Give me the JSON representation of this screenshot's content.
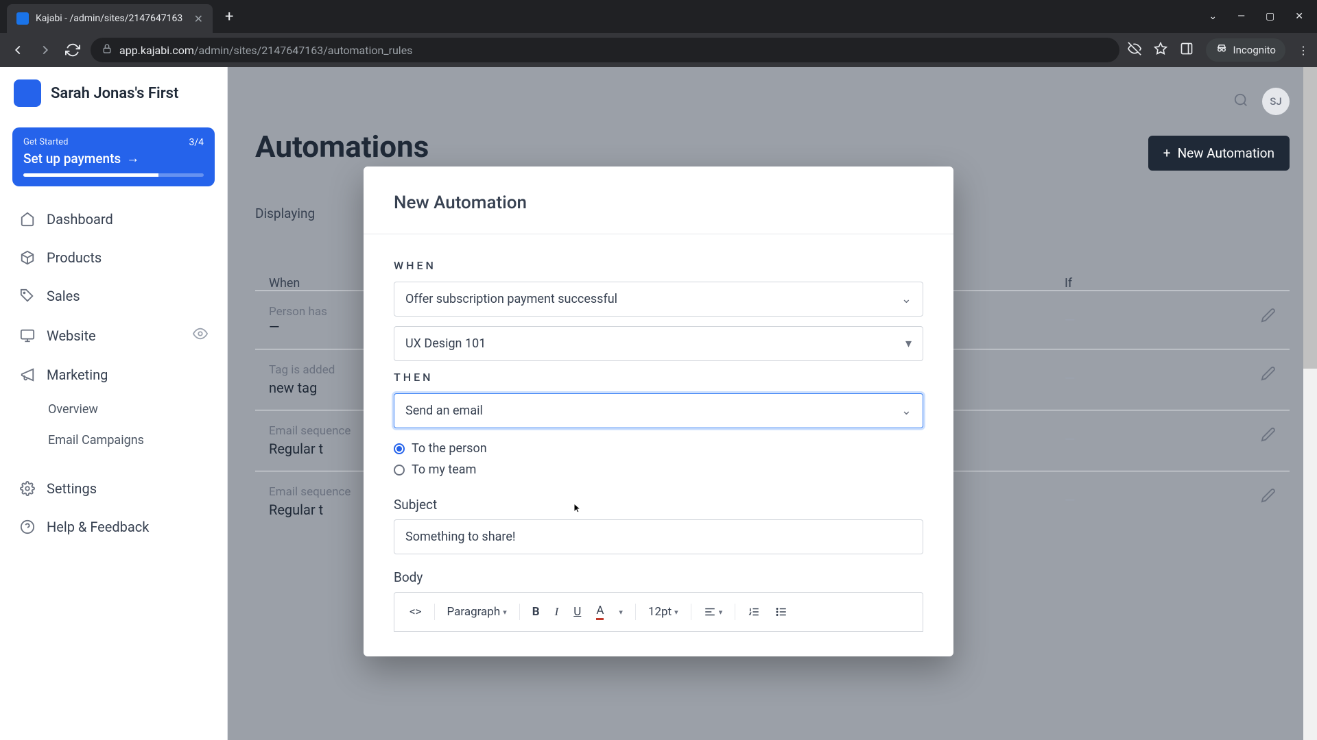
{
  "browser": {
    "tab_title": "Kajabi - /admin/sites/2147647163",
    "url_host": "app.kajabi.com",
    "url_path": "/admin/sites/2147647163/automation_rules",
    "incognito": "Incognito"
  },
  "sidebar": {
    "brand": "Sarah Jonas's First",
    "setup": {
      "small": "Get Started",
      "count": "3/4",
      "main": "Set up payments"
    },
    "items": [
      {
        "label": "Dashboard"
      },
      {
        "label": "Products"
      },
      {
        "label": "Sales"
      },
      {
        "label": "Website"
      },
      {
        "label": "Marketing"
      },
      {
        "label": "Settings"
      },
      {
        "label": "Help & Feedback"
      }
    ],
    "sub": [
      {
        "label": "Overview"
      },
      {
        "label": "Email Campaigns"
      }
    ]
  },
  "topbar": {
    "avatar": "SJ"
  },
  "page": {
    "title": "Automations",
    "new_btn": "New Automation",
    "displaying": "Displaying",
    "cols": {
      "when": "When",
      "if": "If"
    },
    "rows": [
      {
        "title": "Person has",
        "sub": "—"
      },
      {
        "title": "Tag is added",
        "sub": "new tag"
      },
      {
        "title": "Email sequence",
        "sub": "Regular t"
      },
      {
        "title": "Email sequence",
        "sub": "Regular t"
      }
    ]
  },
  "modal": {
    "title": "New Automation",
    "when_label": "WHEN",
    "when_select": "Offer subscription payment successful",
    "when_select2": "UX Design 101",
    "then_label": "THEN",
    "then_select": "Send an email",
    "radio1": "To the person",
    "radio2": "To my team",
    "subject_label": "Subject",
    "subject_value": "Something to share!",
    "body_label": "Body",
    "toolbar": {
      "para": "Paragraph",
      "size": "12pt"
    }
  }
}
